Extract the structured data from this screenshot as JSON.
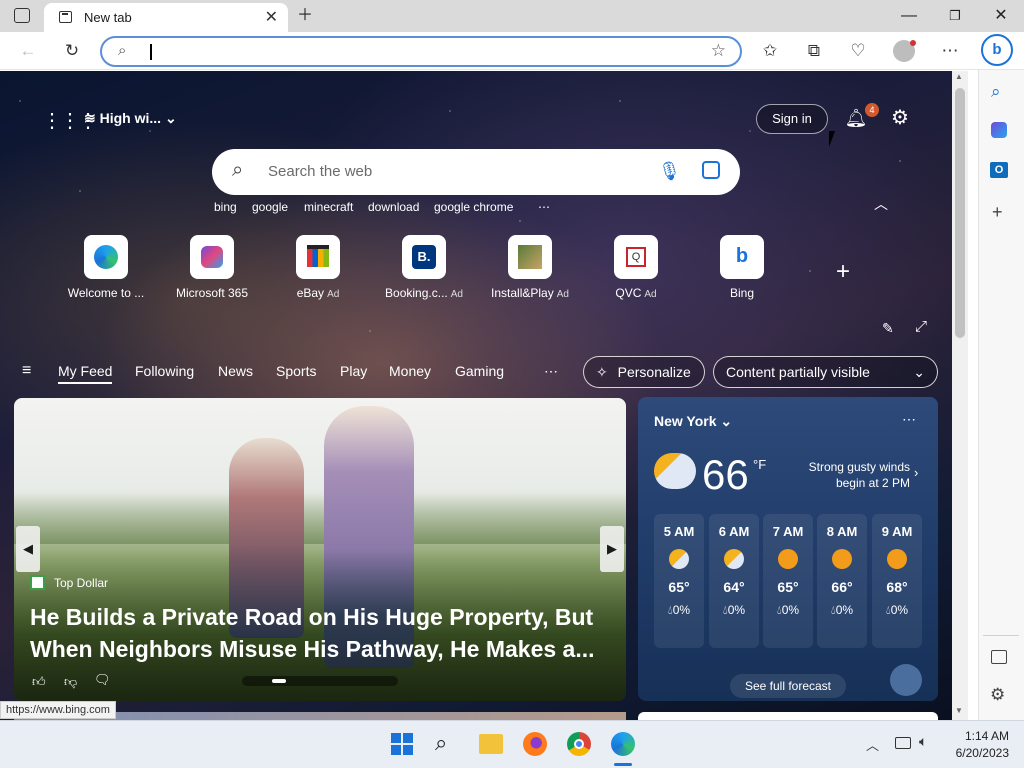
{
  "browser": {
    "tab_title": "New tab",
    "address_value": "",
    "status_url": "https://www.bing.com"
  },
  "page": {
    "weather_chip": "High wi...",
    "sign_in": "Sign in",
    "notifications_count": "4",
    "search_placeholder": "Search the web",
    "trending": [
      "bing",
      "google",
      "minecraft",
      "download",
      "google chrome"
    ],
    "tiles": [
      {
        "label": "Welcome to ...",
        "ad": ""
      },
      {
        "label": "Microsoft 365",
        "ad": ""
      },
      {
        "label": "eBay",
        "ad": "Ad"
      },
      {
        "label": "Booking.c...",
        "ad": "Ad"
      },
      {
        "label": "Install&Play",
        "ad": "Ad"
      },
      {
        "label": "QVC",
        "ad": "Ad"
      },
      {
        "label": "Bing",
        "ad": ""
      }
    ],
    "feed_tabs": [
      "My Feed",
      "Following",
      "News",
      "Sports",
      "Play",
      "Money",
      "Gaming"
    ],
    "personalize": "Personalize",
    "content_visibility": "Content partially visible"
  },
  "hero": {
    "source": "Top Dollar",
    "headline": "He Builds a Private Road on His Huge Property, But When Neighbors Misuse His Pathway, He Makes a..."
  },
  "weather": {
    "location": "New York",
    "temp": "66",
    "unit": "°F",
    "alert": "Strong gusty winds begin at 2 PM",
    "hours": [
      {
        "time": "5 AM",
        "temp": "65°",
        "precip": "0%"
      },
      {
        "time": "6 AM",
        "temp": "64°",
        "precip": "0%"
      },
      {
        "time": "7 AM",
        "temp": "65°",
        "precip": "0%"
      },
      {
        "time": "8 AM",
        "temp": "66°",
        "precip": "0%"
      },
      {
        "time": "9 AM",
        "temp": "68°",
        "precip": "0%"
      }
    ],
    "forecast_link": "See full forecast"
  },
  "taskbar": {
    "time": "1:14 AM",
    "date": "6/20/2023"
  }
}
